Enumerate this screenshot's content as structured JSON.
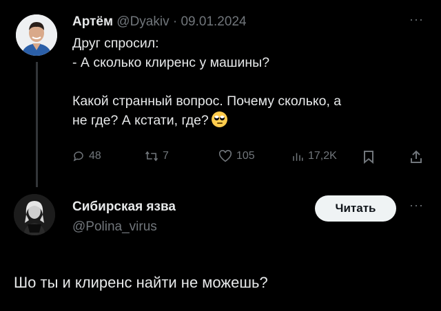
{
  "tweet": {
    "author_name": "Артём",
    "handle": "@Dyakiv",
    "separator": "·",
    "date": "09.01.2024",
    "more": "···",
    "lines": [
      "Друг спросил:",
      "- А сколько клиренс у машины?",
      "Какой странный вопрос. Почему сколько, а",
      "не где? А кстати, где?"
    ],
    "emoji": "face-with-rolling-eyes",
    "actions": {
      "replies": "48",
      "retweets": "7",
      "likes": "105",
      "views": "17,2K"
    }
  },
  "reply": {
    "author_name": "Сибирская язва",
    "handle": "@Polina_virus",
    "follow_label": "Читать",
    "more": "···",
    "text": "Шо ты и клиренс найти не можешь?"
  },
  "colors": {
    "background": "#000000",
    "text": "#e7e9ea",
    "muted": "#71767b",
    "button_bg": "#eff3f4",
    "thread_line": "#333639"
  }
}
